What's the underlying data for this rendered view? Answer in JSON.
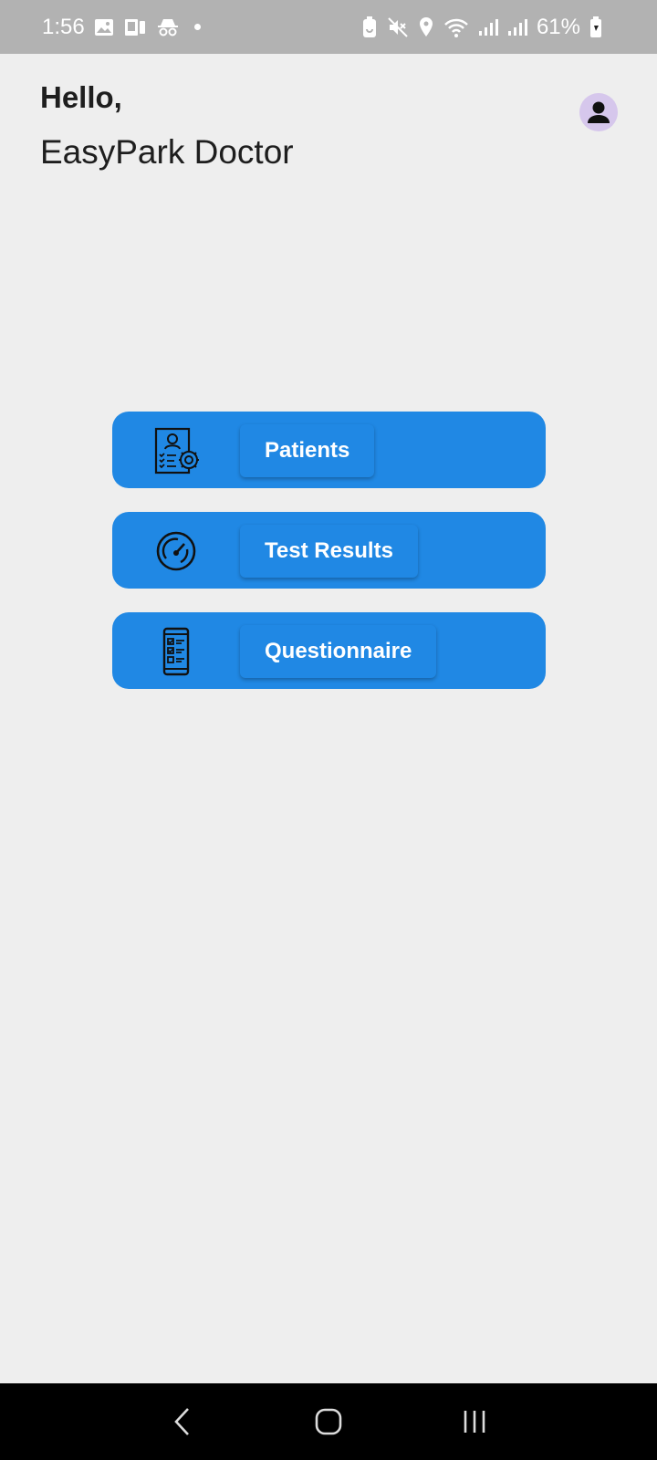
{
  "status_bar": {
    "time": "1:56",
    "battery": "61%",
    "icons": [
      "gallery-icon",
      "cast-icon",
      "incognito-icon",
      "battery-saver-icon",
      "mute-icon",
      "location-icon",
      "wifi-icon",
      "signal-icon",
      "signal-icon",
      "battery-icon"
    ]
  },
  "header": {
    "greeting": "Hello,",
    "username": "EasyPark Doctor"
  },
  "menu": {
    "items": [
      {
        "label": "Patients",
        "icon": "patient-profile-icon"
      },
      {
        "label": "Test Results",
        "icon": "gauge-icon"
      },
      {
        "label": "Questionnaire",
        "icon": "phone-checklist-icon"
      }
    ]
  },
  "colors": {
    "primary": "#2088e4",
    "background": "#eeeeee",
    "avatar_bg": "#d6c7ec"
  }
}
